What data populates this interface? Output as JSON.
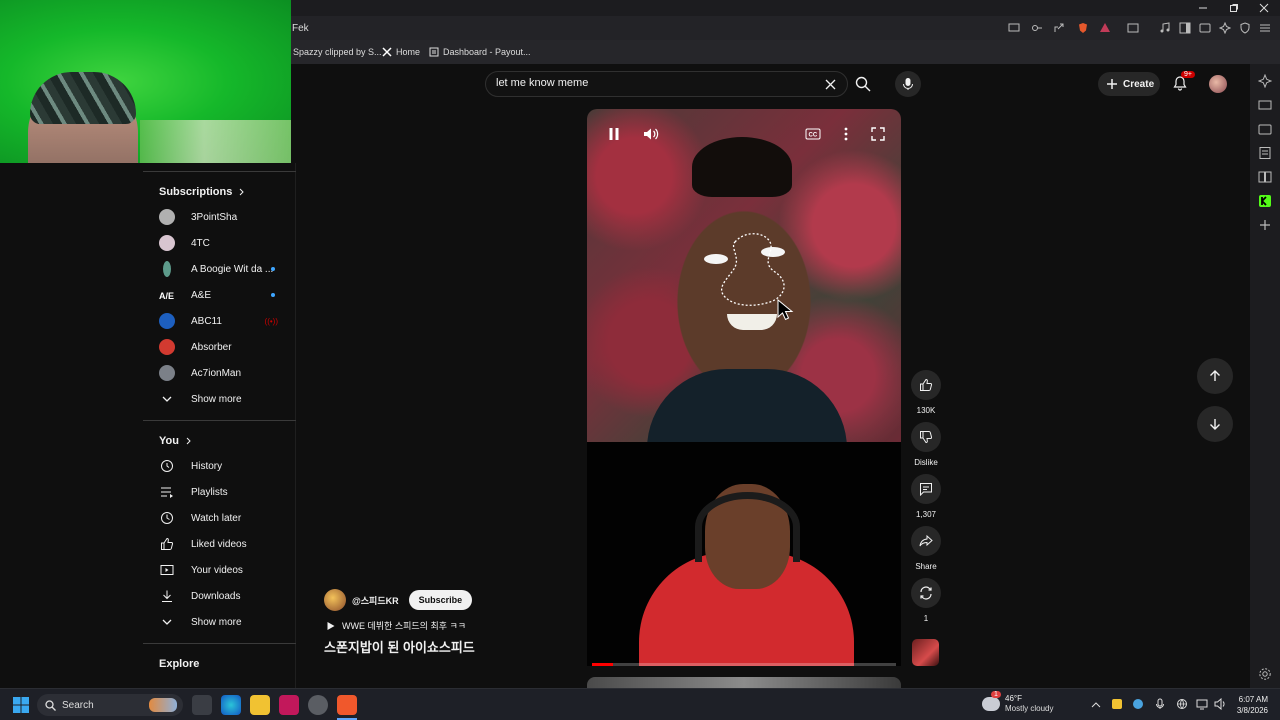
{
  "browser": {
    "tab_title": "Fek",
    "bookmarks": [
      {
        "label": "Spazzy clipped by S...",
        "icon": "clip-icon"
      },
      {
        "label": "Home",
        "icon": "x-logo-icon"
      },
      {
        "label": "Dashboard - Payout...",
        "icon": "dashboard-icon"
      }
    ],
    "window_controls": [
      "minimize",
      "restore",
      "close"
    ]
  },
  "search": {
    "value": "let me know meme",
    "placeholder": "Search"
  },
  "header": {
    "create_label": "Create",
    "notification_count": "9+"
  },
  "sidebar": {
    "subscriptions_title": "Subscriptions",
    "subscriptions": [
      {
        "name": "3PointSha",
        "color": "#b0b0b0",
        "indicator": ""
      },
      {
        "name": "4TC",
        "color": "#d8c5d0",
        "indicator": ""
      },
      {
        "name": "A Boogie Wit da ...",
        "color": "#5d9b8b",
        "indicator": "dot"
      },
      {
        "name": "A&E",
        "color": "#ffffff",
        "indicator": "dot"
      },
      {
        "name": "ABC11",
        "color": "#1d5fbf",
        "indicator": "live"
      },
      {
        "name": "Absorber",
        "color": "#d23a30",
        "indicator": ""
      },
      {
        "name": "Ac7ionMan",
        "color": "#7b8088",
        "indicator": ""
      }
    ],
    "subs_show_more": "Show more",
    "you_title": "You",
    "you_items": [
      {
        "label": "History",
        "icon": "history-icon"
      },
      {
        "label": "Playlists",
        "icon": "playlists-icon"
      },
      {
        "label": "Watch later",
        "icon": "watch-later-icon"
      },
      {
        "label": "Liked videos",
        "icon": "thumbs-up-icon"
      },
      {
        "label": "Your videos",
        "icon": "your-videos-icon"
      },
      {
        "label": "Downloads",
        "icon": "download-icon"
      }
    ],
    "you_show_more": "Show more",
    "explore_title": "Explore"
  },
  "short": {
    "channel": "@스피드KR",
    "subscribe_label": "Subscribe",
    "music": "WWE 데뷔한 스피드의 최후 ㅋㅋ",
    "title": "스폰지밥이 된 아이쇼스피드",
    "progress": 0.07
  },
  "actions": {
    "likes": "130K",
    "dislike_label": "Dislike",
    "comments": "1,307",
    "share_label": "Share",
    "remix_count": "1"
  },
  "taskbar": {
    "search_label": "Search",
    "weather_temp": "46°F",
    "weather_desc": "Mostly cloudy",
    "time": "6:07 AM",
    "date": "3/8/2026",
    "weather_badge": "1"
  }
}
